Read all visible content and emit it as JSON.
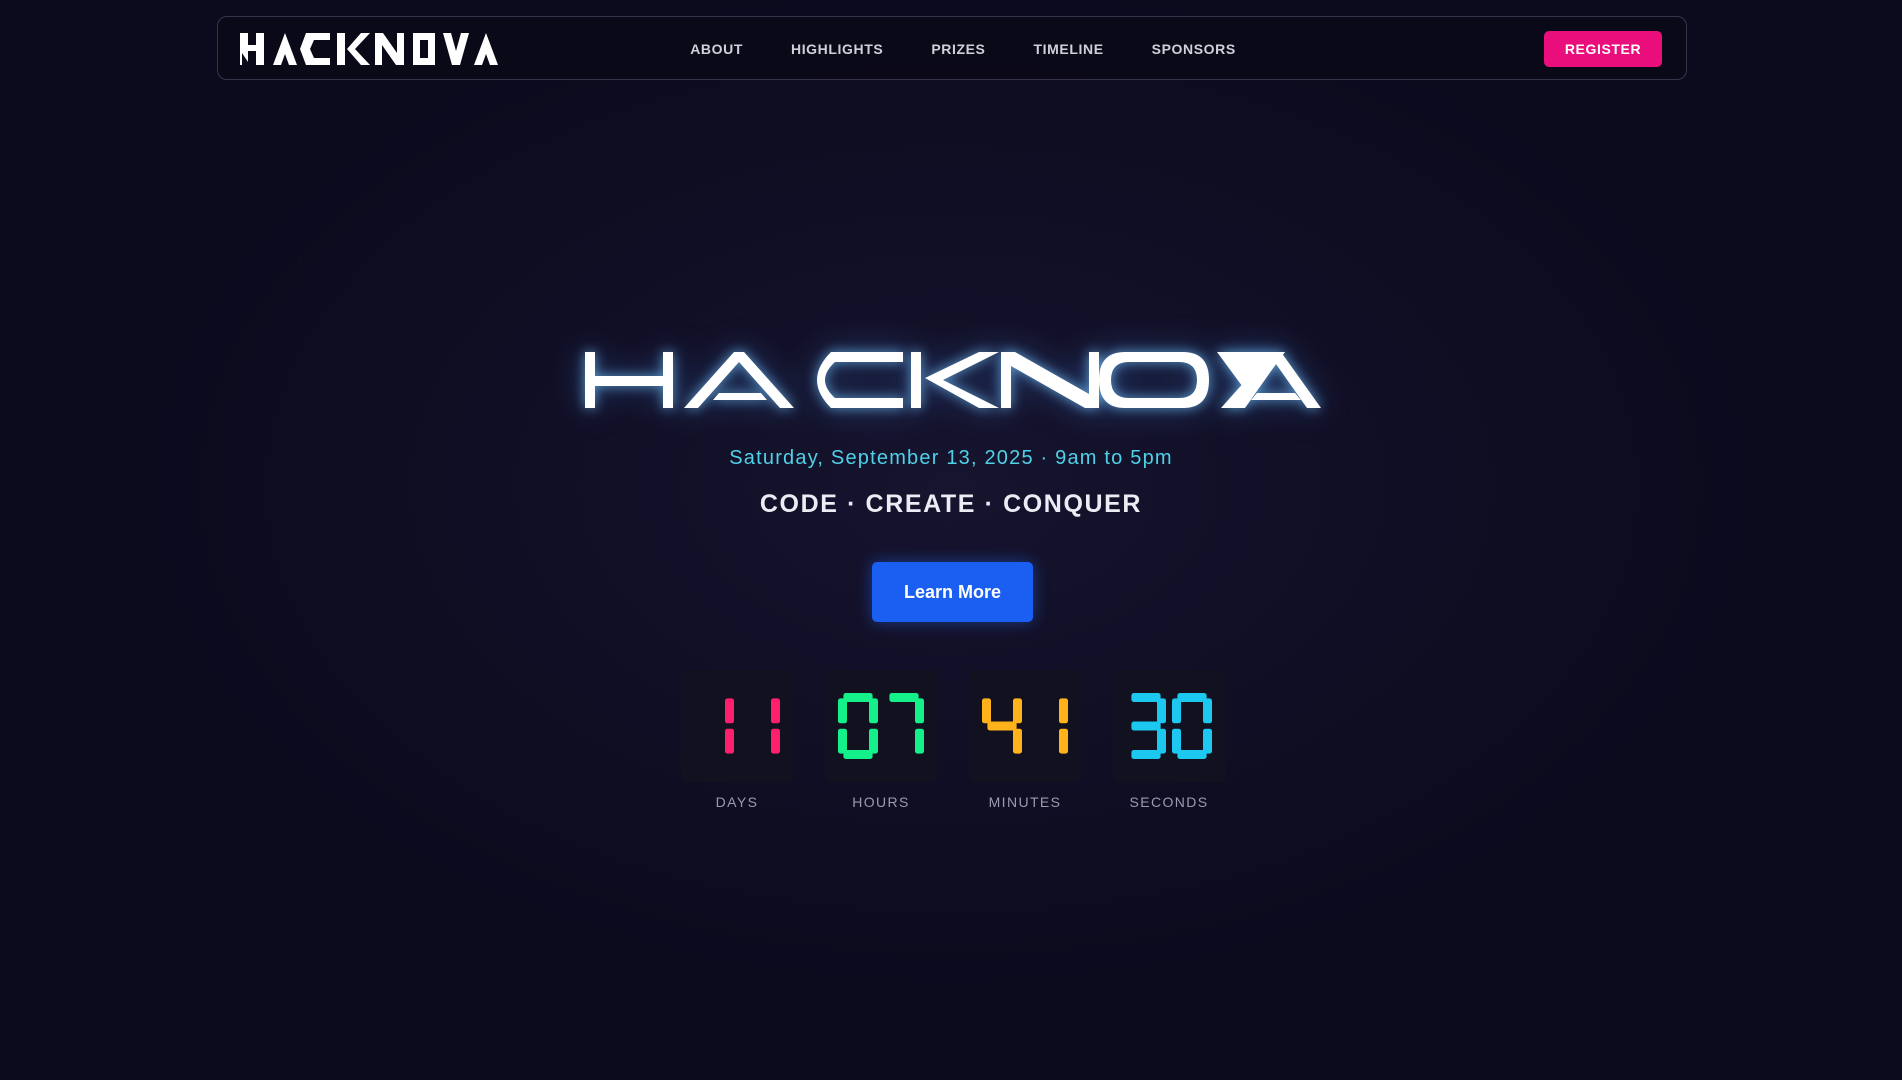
{
  "brand": {
    "logo_text": "HACKNOVA",
    "hero_title": "HACKNOVA"
  },
  "nav": {
    "links": [
      {
        "label": "ABOUT"
      },
      {
        "label": "HIGHLIGHTS"
      },
      {
        "label": "PRIZES"
      },
      {
        "label": "TIMELINE"
      },
      {
        "label": "SPONSORS"
      }
    ],
    "register_label": "REGISTER"
  },
  "hero": {
    "date_line": "Saturday, September 13, 2025 · 9am to 5pm",
    "tagline": "CODE · CREATE · CONQUER",
    "cta_label": "Learn More"
  },
  "countdown": {
    "units": [
      {
        "value": "11",
        "label": "DAYS",
        "color": "#ff1f6d"
      },
      {
        "value": "07",
        "label": "HOURS",
        "color": "#14f08a"
      },
      {
        "value": "41",
        "label": "MINUTES",
        "color": "#ffb21a"
      },
      {
        "value": "30",
        "label": "SECONDS",
        "color": "#1cc8f0"
      }
    ]
  },
  "colors": {
    "background": "#0c0a1d",
    "register": "#ea0d7c",
    "cta": "#1b5ef2",
    "date_text": "#4fd1e8"
  }
}
